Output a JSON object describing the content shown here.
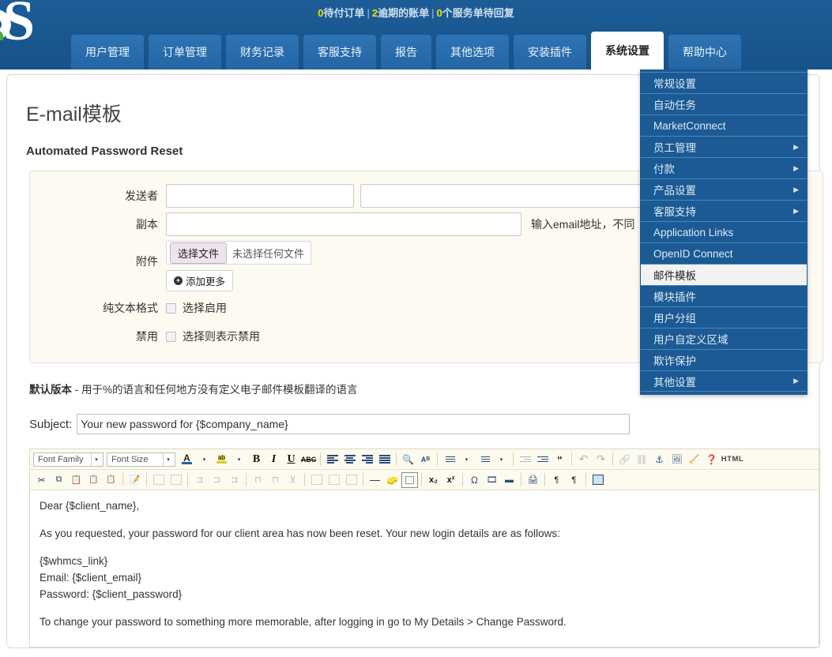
{
  "header": {
    "status": {
      "pending_orders_count": "0",
      "pending_orders_label": "待付订单",
      "overdue_count": "2",
      "overdue_label": "逾期的账单",
      "tickets_count": "0",
      "tickets_label": "个服务单待回复",
      "separator": "|"
    },
    "logo_alt": "whmcs-logo"
  },
  "nav": {
    "tabs": [
      {
        "label": "用户管理",
        "active": false
      },
      {
        "label": "订单管理",
        "active": false
      },
      {
        "label": "财务记录",
        "active": false
      },
      {
        "label": "客服支持",
        "active": false
      },
      {
        "label": "报告",
        "active": false
      },
      {
        "label": "其他选项",
        "active": false
      },
      {
        "label": "安装插件",
        "active": false
      },
      {
        "label": "系统设置",
        "active": true
      },
      {
        "label": "帮助中心",
        "active": false
      }
    ]
  },
  "dropdown": {
    "items": [
      {
        "label": "常规设置",
        "submenu": false,
        "selected": false
      },
      {
        "label": "自动任务",
        "submenu": false,
        "selected": false
      },
      {
        "label": "MarketConnect",
        "submenu": false,
        "selected": false
      },
      {
        "label": "员工管理",
        "submenu": true,
        "selected": false
      },
      {
        "label": "付款",
        "submenu": true,
        "selected": false
      },
      {
        "label": "产品设置",
        "submenu": true,
        "selected": false
      },
      {
        "label": "客服支持",
        "submenu": true,
        "selected": false
      },
      {
        "label": "Application Links",
        "submenu": false,
        "selected": false
      },
      {
        "label": "OpenID Connect",
        "submenu": false,
        "selected": false
      },
      {
        "label": "邮件模板",
        "submenu": false,
        "selected": true
      },
      {
        "label": "模块插件",
        "submenu": false,
        "selected": false
      },
      {
        "label": "用户分组",
        "submenu": false,
        "selected": false
      },
      {
        "label": "用户自定义区域",
        "submenu": false,
        "selected": false
      },
      {
        "label": "欺诈保护",
        "submenu": false,
        "selected": false
      },
      {
        "label": "其他设置",
        "submenu": true,
        "selected": false
      }
    ],
    "arrow_glyph": "▶"
  },
  "main": {
    "page_title": "E-mail模板",
    "section_title": "Automated Password Reset",
    "form": {
      "sender_label": "发送者",
      "sender_name_value": "",
      "sender_email_value": "",
      "cc_label": "副本",
      "cc_value": "",
      "cc_hint": "输入email地址，不同",
      "attachment_label": "附件",
      "choose_file_button": "选择文件",
      "no_file_text": "未选择任何文件",
      "add_more_button": "添加更多",
      "add_more_icon": "+",
      "plaintext_label": "纯文本格式",
      "plaintext_checkbox_label": "选择启用",
      "disable_label": "禁用",
      "disable_checkbox_label": "选择则表示禁用"
    },
    "default_version": {
      "bold": "默认版本",
      "rest": " - 用于%的语言和任何地方没有定义电子邮件模板翻译的语言"
    },
    "subject": {
      "label": "Subject:",
      "value": "Your new password for {$company_name}"
    },
    "editor": {
      "font_family_label": "Font Family",
      "font_size_label": "Font Size",
      "html_label": "HTML",
      "caret_glyph": "▾",
      "row1_icons": [
        "text-color-icon",
        "text-color-dropdown",
        "background-color-icon",
        "background-color-dropdown",
        "bold-icon",
        "italic-icon",
        "underline-icon",
        "strikethrough-icon",
        "align-left-icon",
        "align-center-icon",
        "align-right-icon",
        "align-justify-icon",
        "find-icon",
        "find-replace-icon",
        "bullet-list-icon",
        "bullet-list-dropdown",
        "numbered-list-icon",
        "numbered-list-dropdown",
        "outdent-icon",
        "indent-icon",
        "blockquote-icon",
        "undo-icon",
        "redo-icon",
        "insert-link-icon",
        "unlink-icon",
        "anchor-icon",
        "insert-image-icon",
        "cleanup-icon",
        "help-icon",
        "html-source-icon"
      ],
      "row2_icons": [
        "cut-icon",
        "copy-icon",
        "paste-icon",
        "paste-text-icon",
        "paste-word-icon",
        "edit-css-icon",
        "table-icon",
        "table-properties-icon",
        "row-properties-icon",
        "insert-row-before-icon",
        "insert-row-after-icon",
        "delete-row-icon",
        "insert-column-before-icon",
        "insert-column-after-icon",
        "delete-column-icon",
        "split-cells-icon",
        "merge-cells-icon",
        "horizontal-rule-icon",
        "remove-format-icon",
        "visual-aid-icon",
        "subscript-icon",
        "superscript-icon",
        "special-character-icon",
        "insert-media-icon",
        "page-break-icon",
        "print-icon",
        "ltr-icon",
        "rtl-icon",
        "fullscreen-icon"
      ],
      "body": {
        "greeting": "Dear {$client_name},",
        "paragraph1": "As you requested, your password for our client area has now been reset. Your new login details are as follows:",
        "detail_line1": "{$whmcs_link}",
        "detail_line2": "Email: {$client_email}",
        "detail_line3": "Password: {$client_password}",
        "paragraph2": "To change your password to something more memorable, after logging in go to My Details > Change Password."
      }
    }
  },
  "colors": {
    "header_blue": "#1b5a94",
    "tab_blue": "#2a6fb0",
    "accent_yellow": "#f6e000",
    "panel_bg": "#fdfaf2",
    "panel_border": "#ead9e6",
    "toolbar_bg": "#fdfbef"
  }
}
